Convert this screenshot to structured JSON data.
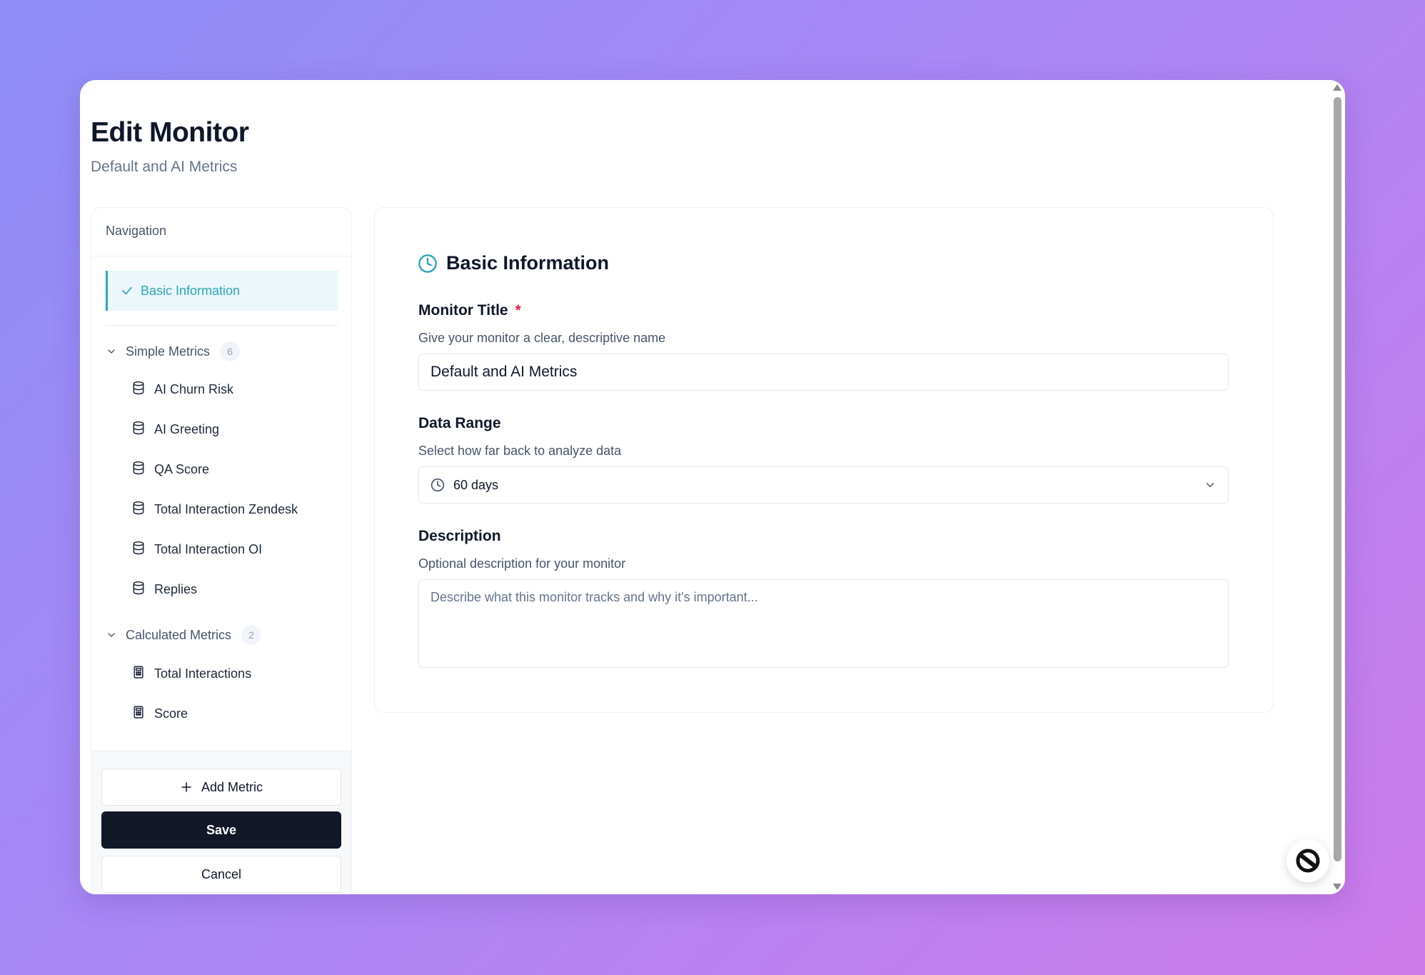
{
  "page": {
    "title": "Edit Monitor",
    "subtitle": "Default and AI Metrics"
  },
  "sidebar": {
    "header": "Navigation",
    "active_item": "Basic Information",
    "groups": [
      {
        "label": "Simple Metrics",
        "count": "6",
        "items": [
          "AI Churn Risk",
          "AI Greeting",
          "QA Score",
          "Total Interaction Zendesk",
          "Total Interaction OI",
          "Replies"
        ]
      },
      {
        "label": "Calculated Metrics",
        "count": "2",
        "items": [
          "Total Interactions",
          "Score"
        ]
      }
    ],
    "add_metric_label": "Add Metric",
    "save_label": "Save",
    "cancel_label": "Cancel"
  },
  "form": {
    "section_title": "Basic Information",
    "monitor_title": {
      "label": "Monitor Title",
      "required_mark": "*",
      "hint": "Give your monitor a clear, descriptive name",
      "value": "Default and AI Metrics"
    },
    "data_range": {
      "label": "Data Range",
      "hint": "Select how far back to analyze data",
      "value": "60 days"
    },
    "description": {
      "label": "Description",
      "hint": "Optional description for your monitor",
      "placeholder": "Describe what this monitor tracks and why it's important..."
    }
  },
  "colors": {
    "accent": "#2aa6b8",
    "primary_button": "#121827",
    "required": "#e11d48"
  },
  "icons": {
    "active_item": "check-icon",
    "simple_metric": "database-icon",
    "calculated_metric": "calculator-icon",
    "section": "clock-icon",
    "group_toggle": "chevron-down-icon",
    "add": "plus-icon",
    "widget": "chat-widget-icon"
  }
}
